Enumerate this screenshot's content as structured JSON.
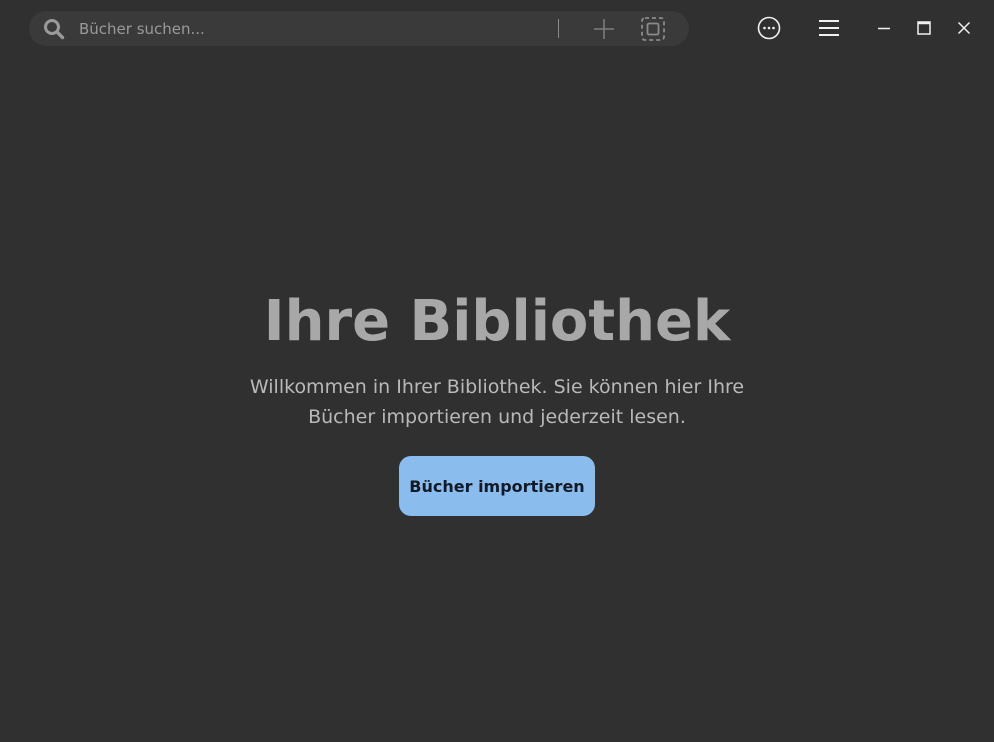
{
  "search": {
    "placeholder": "Bücher suchen..."
  },
  "icons": {
    "search": "search-icon",
    "add": "plus-icon",
    "select": "select-frame-icon",
    "more": "more-horizontal-circle-icon",
    "menu": "hamburger-menu-icon",
    "minimize": "minimize-icon",
    "maximize": "maximize-icon",
    "close": "close-icon"
  },
  "main": {
    "title": "Ihre Bibliothek",
    "subtitle": "Willkommen in Ihrer Bibliothek. Sie können hier Ihre Bücher importieren und jederzeit lesen.",
    "import_label": "Bücher importieren"
  },
  "colors": {
    "background": "#303030",
    "searchbar": "#3a3a3a",
    "accent": "#8bbcee",
    "title": "#a8a8a8"
  }
}
